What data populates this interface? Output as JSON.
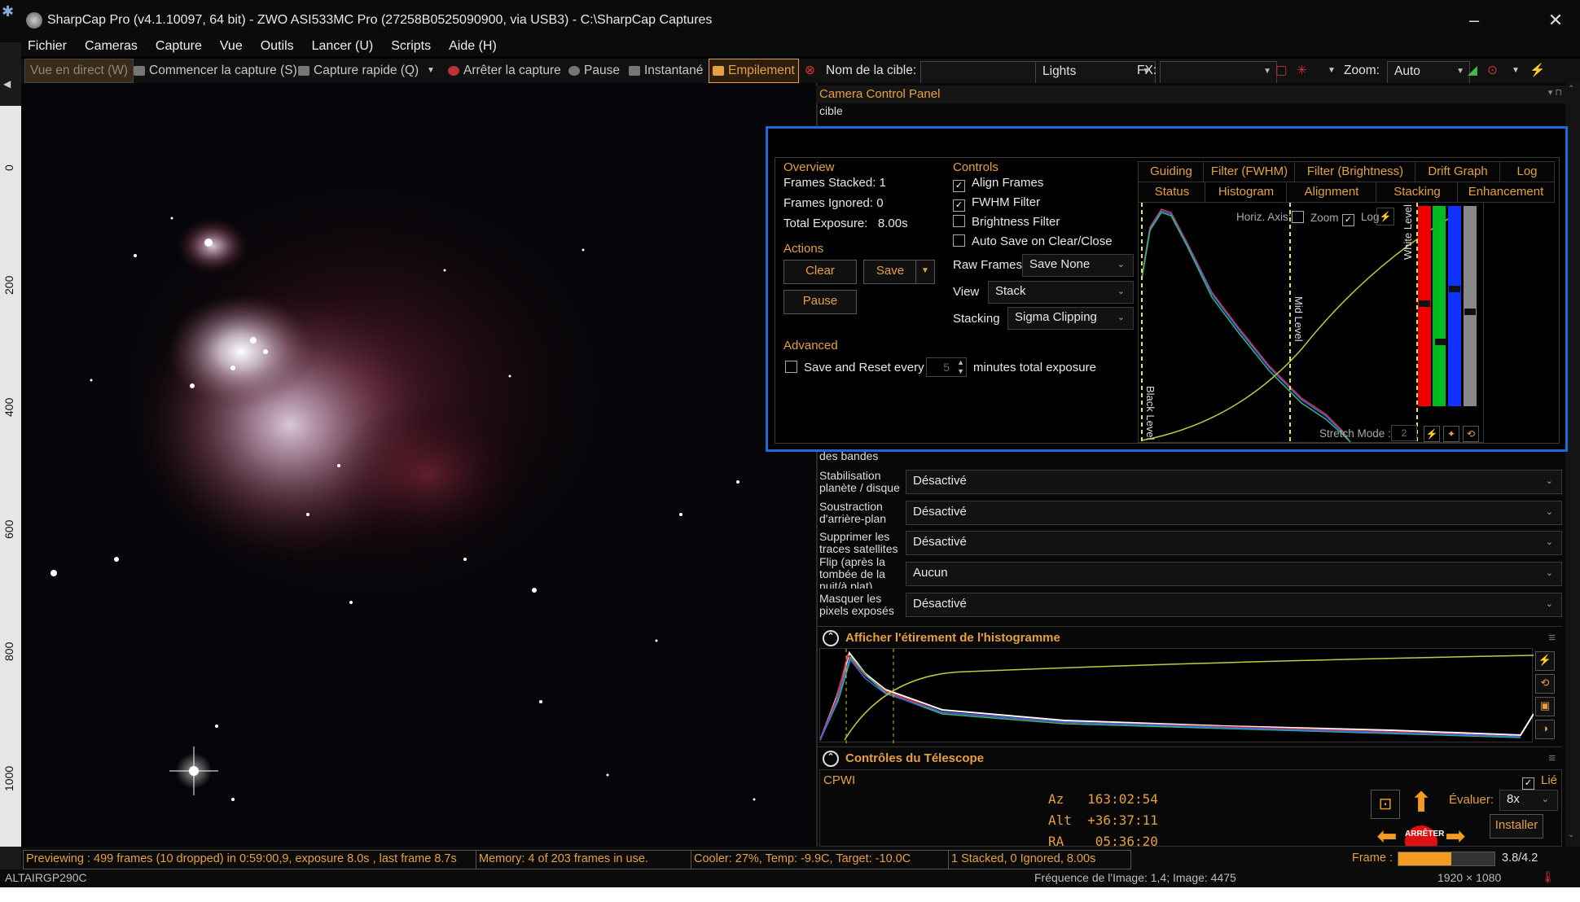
{
  "window": {
    "title": "SharpCap Pro (v4.1.10097, 64 bit) - ZWO ASI533MC Pro (27258B0525090900, via USB3) - C:\\SharpCap Captures",
    "minimize": "–",
    "close": "✕"
  },
  "menu": [
    "Fichier",
    "Cameras",
    "Capture",
    "Vue",
    "Outils",
    "Lancer (U)",
    "Scripts",
    "Aide (H)"
  ],
  "toolbar": {
    "live": "Vue en direct (W)",
    "start_capture": "Commencer la capture (S)",
    "quick_capture": "Capture rapide (Q)",
    "stop_capture": "Arrêter la capture",
    "pause": "Pause",
    "snapshot": "Instantané",
    "stack": "Empilement",
    "target_label": "Nom de la cible:",
    "target_value": "",
    "frame_type": "Lights",
    "fx_label": "FX:",
    "fx_value": "",
    "zoom_label": "Zoom:",
    "zoom_value": "Auto"
  },
  "ruler_labels": [
    "0",
    "200",
    "400",
    "600",
    "800",
    "1000"
  ],
  "camera_panel": {
    "title": "Camera Control Panel",
    "partial_label_top": "cible",
    "partial_label_bands": "des bandes",
    "rows": [
      {
        "label": "Stabilisation planète / disque",
        "value": "Désactivé"
      },
      {
        "label": "Soustraction d'arrière-plan",
        "value": "Désactivé"
      },
      {
        "label": "Supprimer les traces satellites",
        "value": "Désactivé"
      },
      {
        "label": "Flip (après la tombée de la nuit/à plat)",
        "value": "Aucun"
      },
      {
        "label": "Masquer les pixels exposés",
        "value": "Désactivé"
      }
    ],
    "histogram_section": "Afficher l'étirement de l'histogramme",
    "telescope_section": "Contrôles du Télescope",
    "telescope": {
      "mount": "CPWI",
      "linked_label": "Lié",
      "linked": true,
      "az": "Az   163:02:54",
      "alt": "Alt  +36:37:11",
      "ra": "RA    05:36:20",
      "rate_label": "Évaluer:",
      "rate_value": "8x",
      "install": "Installer",
      "stop": "ARRÊTER"
    }
  },
  "stack_window": {
    "overview": {
      "heading": "Overview",
      "frames_stacked": "Frames Stacked: 1",
      "frames_ignored": "Frames Ignored: 0",
      "total_exposure": "Total Exposure:   8.00s"
    },
    "actions": {
      "heading": "Actions",
      "clear": "Clear",
      "save": "Save",
      "pause": "Pause"
    },
    "advanced": {
      "heading": "Advanced",
      "save_reset": "Save and Reset every",
      "minutes_value": "5",
      "minutes_label": "minutes total exposure"
    },
    "controls": {
      "heading": "Controls",
      "align": "Align Frames",
      "align_checked": true,
      "fwhm": "FWHM Filter",
      "fwhm_checked": true,
      "brightness": "Brightness Filter",
      "brightness_checked": false,
      "autosave": "Auto Save on Clear/Close",
      "autosave_checked": false,
      "raw_label": "Raw Frames",
      "raw_value": "Save None",
      "view_label": "View",
      "view_value": "Stack",
      "stacking_label": "Stacking",
      "stacking_value": "Sigma Clipping"
    },
    "tabs_top": [
      "Guiding",
      "Filter (FWHM)",
      "Filter (Brightness)",
      "Drift Graph",
      "Log"
    ],
    "tabs_bottom": [
      "Status",
      "Histogram",
      "Alignment",
      "Stacking",
      "Enhancement"
    ],
    "active_tab": "Histogram",
    "histogram": {
      "horiz_axis": "Horiz. Axis:",
      "zoom": "Zoom",
      "log": "Log",
      "black_level": "Black Level",
      "mid_level": "Mid Level",
      "white_level": "White Level",
      "stretch_mode": "Stretch Mode :",
      "stretch_value": "2"
    }
  },
  "status": {
    "preview": "Previewing : 499 frames (10 dropped) in 0:59:00,9, exposure 8.0s , last frame 8.7s",
    "memory": "Memory: 4 of 203 frames in use.",
    "cooler": "Cooler: 27%, Temp: -9.9C, Target: -10.0C",
    "stacked": "1 Stacked, 0 Ignored, 8.00s",
    "frame_label": "Frame :",
    "frame_value": "3.8/4.2",
    "frame_fill": 0.55
  },
  "bottom": {
    "device": "ALTAIRGP290C",
    "framerate": "Fréquence de l'Image: 1,4; Image: 4475",
    "resolution": "1920 × 1080"
  },
  "colors": {
    "accent": "#e6a040",
    "highlight": "#1e6ad8",
    "background": "#000000"
  }
}
